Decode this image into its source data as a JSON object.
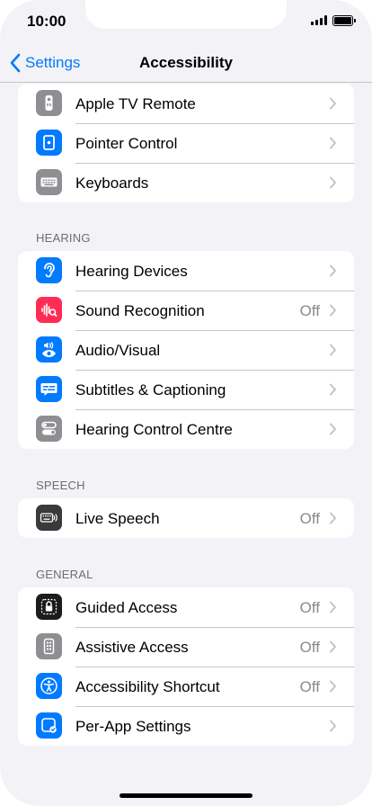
{
  "status_bar": {
    "time": "10:00"
  },
  "nav": {
    "back_label": "Settings",
    "title": "Accessibility"
  },
  "groups": {
    "top": {
      "items": [
        {
          "label": "Apple TV Remote",
          "value": "",
          "icon": "remote-icon",
          "color": "#8e8e93"
        },
        {
          "label": "Pointer Control",
          "value": "",
          "icon": "pointer-icon",
          "color": "#007aff"
        },
        {
          "label": "Keyboards",
          "value": "",
          "icon": "keyboard-icon",
          "color": "#8e8e93"
        }
      ]
    },
    "hearing": {
      "header": "HEARING",
      "items": [
        {
          "label": "Hearing Devices",
          "value": "",
          "icon": "ear-icon",
          "color": "#007aff"
        },
        {
          "label": "Sound Recognition",
          "value": "Off",
          "icon": "waveform-icon",
          "color": "#ff2d55"
        },
        {
          "label": "Audio/Visual",
          "value": "",
          "icon": "speaker-eye-icon",
          "color": "#007aff"
        },
        {
          "label": "Subtitles & Captioning",
          "value": "",
          "icon": "captions-icon",
          "color": "#007aff"
        },
        {
          "label": "Hearing Control Centre",
          "value": "",
          "icon": "toggles-icon",
          "color": "#8e8e93"
        }
      ]
    },
    "speech": {
      "header": "SPEECH",
      "items": [
        {
          "label": "Live Speech",
          "value": "Off",
          "icon": "live-speech-keyboard-icon",
          "color": "#3a3a3c"
        }
      ]
    },
    "general": {
      "header": "GENERAL",
      "items": [
        {
          "label": "Guided Access",
          "value": "Off",
          "icon": "lock-icon",
          "color": "#1c1c1e"
        },
        {
          "label": "Assistive Access",
          "value": "Off",
          "icon": "assistive-grid-icon",
          "color": "#8e8e93"
        },
        {
          "label": "Accessibility Shortcut",
          "value": "Off",
          "icon": "accessibility-person-icon",
          "color": "#007aff"
        },
        {
          "label": "Per-App Settings",
          "value": "",
          "icon": "app-settings-icon",
          "color": "#007aff"
        }
      ]
    }
  },
  "colors": {
    "accent": "#007aff",
    "background": "#f2f2f7"
  }
}
